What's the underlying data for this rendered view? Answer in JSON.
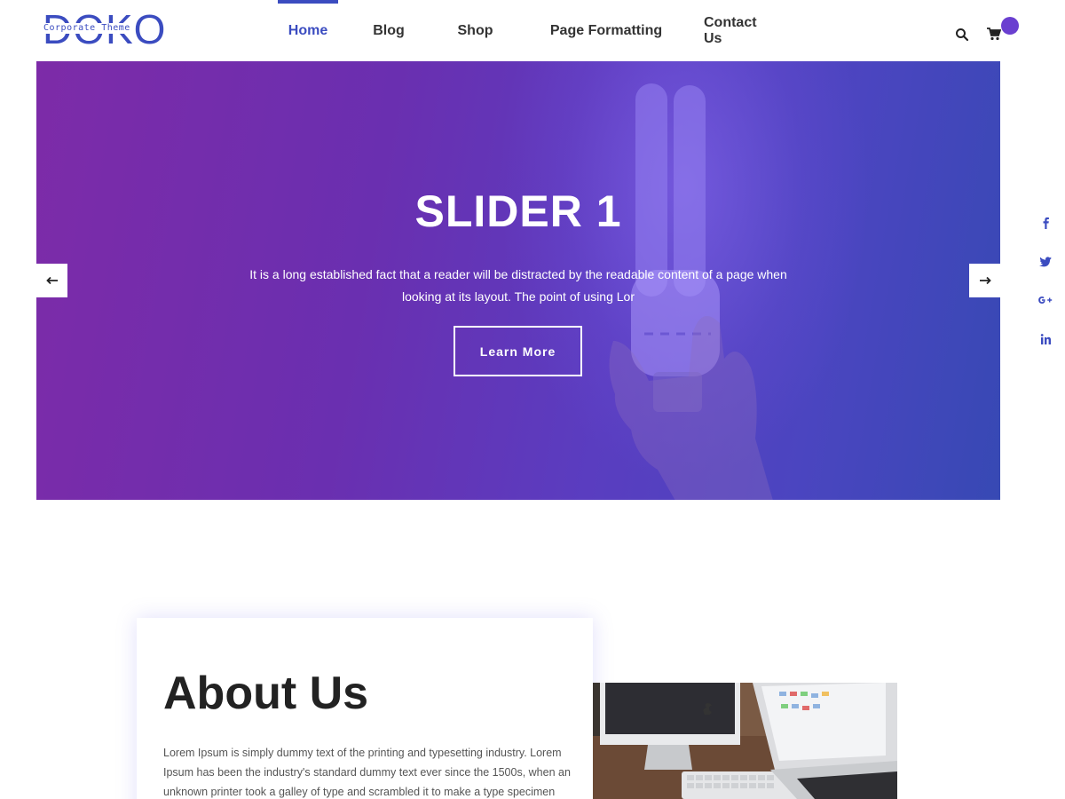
{
  "logo": {
    "main": "DOKO",
    "tagline": "Corporate Theme"
  },
  "nav": {
    "items": [
      {
        "label": "Home",
        "active": true
      },
      {
        "label": "Blog",
        "active": false
      },
      {
        "label": "Shop",
        "active": false
      },
      {
        "label": "Page Formatting",
        "active": false
      },
      {
        "label": "Contact Us",
        "active": false
      }
    ]
  },
  "header_icons": [
    "search-icon",
    "cart-icon"
  ],
  "hero": {
    "title": "SLIDER 1",
    "description": "It is a long established fact that a reader will be distracted by the readable content of a page when looking at its layout. The point of using Lor",
    "button_label": "Learn More"
  },
  "social": [
    "facebook-icon",
    "twitter-icon",
    "google-plus-icon",
    "linkedin-icon"
  ],
  "about": {
    "title": "About Us",
    "text": "Lorem Ipsum is simply dummy text of the printing and typesetting industry. Lorem Ipsum has been the industry's standard dummy text ever since the 1500s, when an unknown printer took a galley of type and scrambled it to make a type specimen book. It"
  },
  "colors": {
    "accent": "#3b4cc0",
    "hero_start": "#7d2ba8",
    "hero_end": "#3749b4",
    "badge": "#6a3fd0"
  }
}
